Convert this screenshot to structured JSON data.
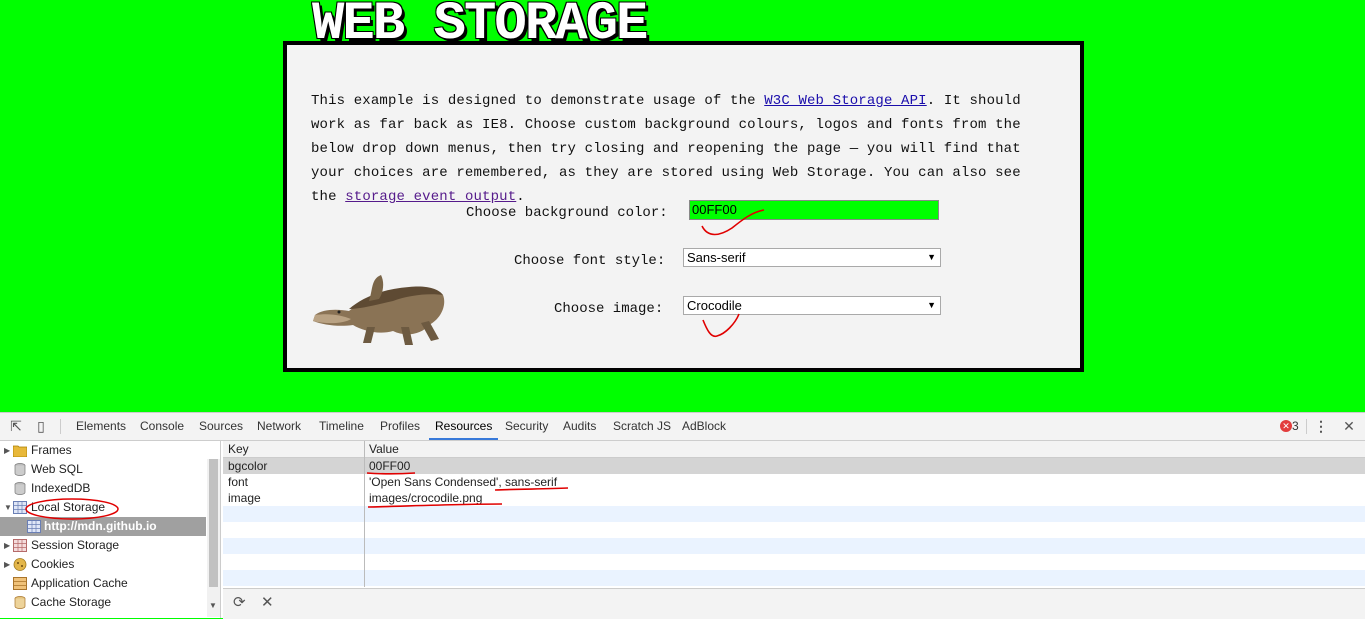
{
  "page": {
    "title": "WEB STORAGE",
    "intro_pre": "This example is designed to demonstrate usage of the ",
    "intro_link1": "W3C Web Storage API",
    "intro_mid": ". It should work as far back as IE8. Choose custom background colours, logos and fonts from the below drop down menus, then try closing and reopening the page — you will find that your choices are remembered, as they are stored using Web Storage. You can also see the ",
    "intro_link2": "storage event output",
    "intro_post": ".",
    "bg_label": "Choose background color:",
    "bg_value": "00FF00",
    "font_label": "Choose font style:",
    "font_value": "Sans-serif",
    "image_label": "Choose image:",
    "image_value": "Crocodile",
    "image_icon": "crocodile-image",
    "colors": {
      "background": "#00ff00",
      "annotation": "#e00000"
    }
  },
  "devtools": {
    "tabs": [
      "Elements",
      "Console",
      "Sources",
      "Network",
      "Timeline",
      "Profiles",
      "Resources",
      "Security",
      "Audits",
      "Scratch JS",
      "AdBlock"
    ],
    "active_tab": "Resources",
    "error_count": "3",
    "sidebar": [
      {
        "label": "Frames",
        "icon": "folder-icon"
      },
      {
        "label": "Web SQL",
        "icon": "database-icon"
      },
      {
        "label": "IndexedDB",
        "icon": "database-icon"
      },
      {
        "label": "Local Storage",
        "icon": "table-icon"
      },
      {
        "label": "http://mdn.github.io",
        "icon": "table-icon"
      },
      {
        "label": "Session Storage",
        "icon": "table-icon"
      },
      {
        "label": "Cookies",
        "icon": "cookie-icon"
      },
      {
        "label": "Application Cache",
        "icon": "grid-icon"
      },
      {
        "label": "Cache Storage",
        "icon": "database-icon"
      }
    ],
    "grid": {
      "headers": {
        "key": "Key",
        "value": "Value"
      },
      "rows": [
        {
          "key": "bgcolor",
          "value": "00FF00"
        },
        {
          "key": "font",
          "value": "'Open Sans Condensed', sans-serif"
        },
        {
          "key": "image",
          "value": "images/crocodile.png"
        }
      ]
    }
  }
}
